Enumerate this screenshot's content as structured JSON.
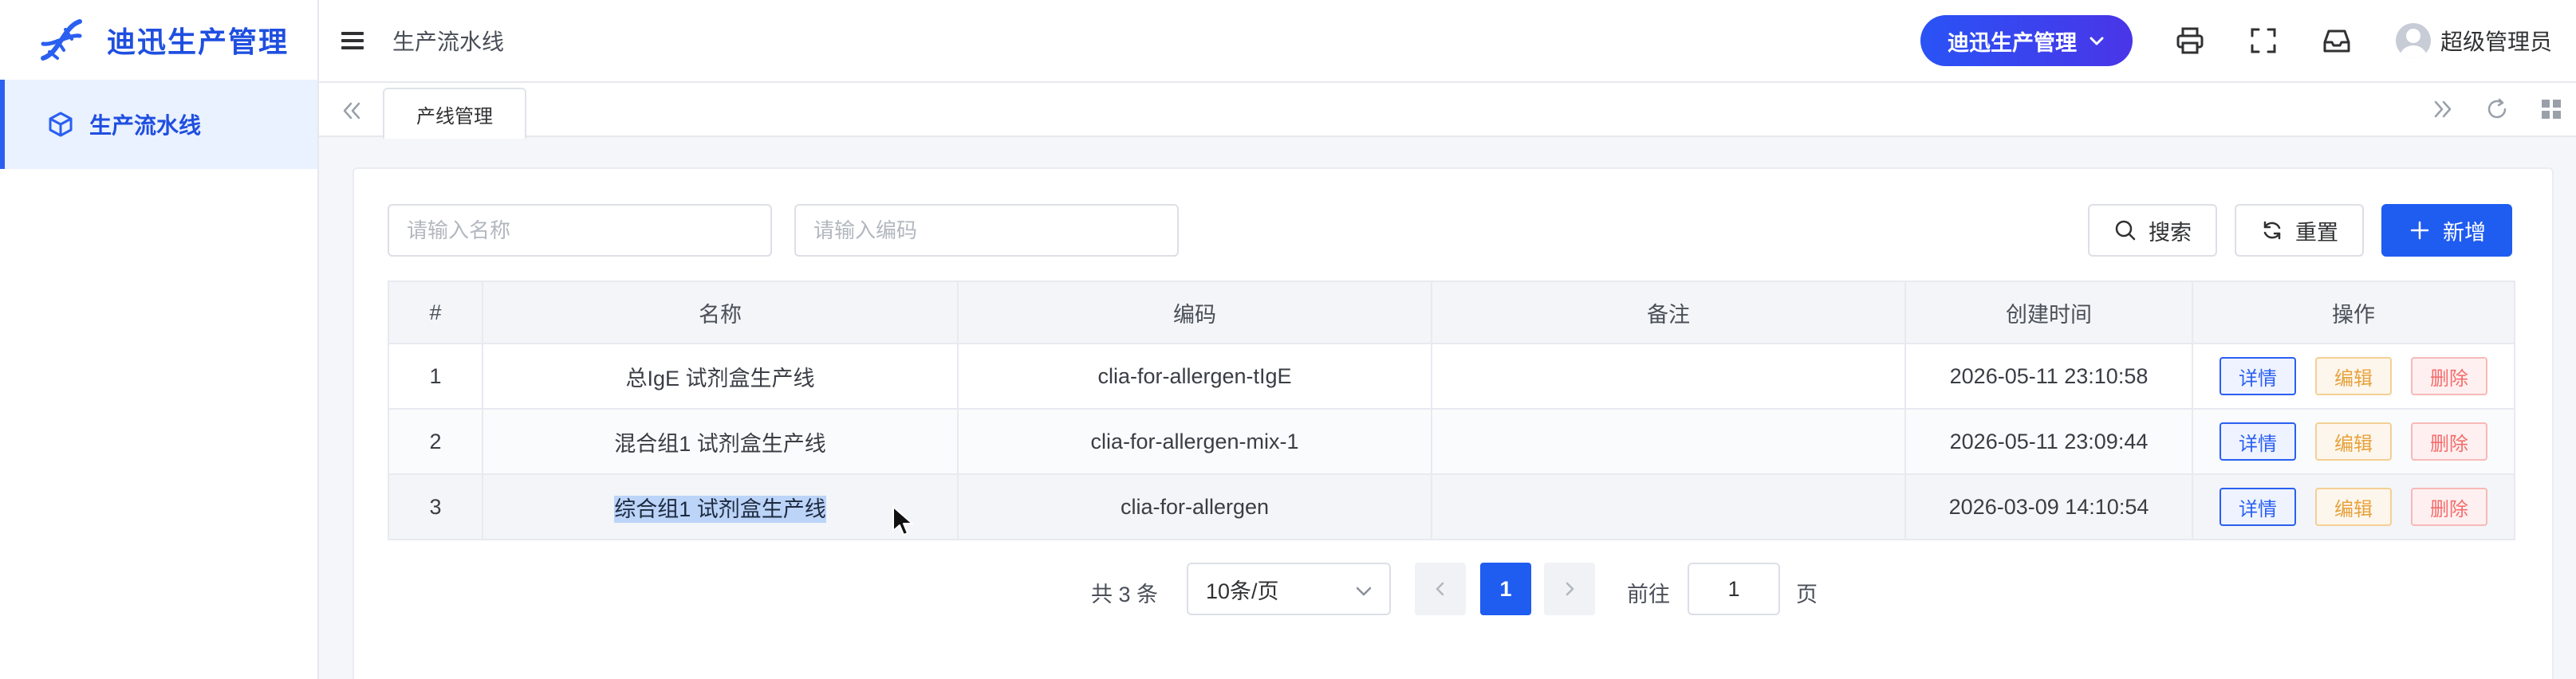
{
  "app": {
    "title": "迪迅生产管理"
  },
  "sidebar": {
    "items": [
      {
        "label": "生产流水线",
        "icon": "cube-icon",
        "active": true
      }
    ]
  },
  "header": {
    "breadcrumb": "生产流水线",
    "app_switch_label": "迪迅生产管理",
    "user_name": "超级管理员"
  },
  "tabs": [
    {
      "label": "产线管理",
      "active": true
    }
  ],
  "search": {
    "name_placeholder": "请输入名称",
    "code_placeholder": "请输入编码",
    "search_label": "搜索",
    "reset_label": "重置",
    "add_label": "新增"
  },
  "table": {
    "columns": [
      "#",
      "名称",
      "编码",
      "备注",
      "创建时间",
      "操作"
    ],
    "rows": [
      {
        "index": "1",
        "name": "总IgE 试剂盒生产线",
        "code": "clia-for-allergen-tIgE",
        "remark": "",
        "created": "2026-05-11 23:10:58"
      },
      {
        "index": "2",
        "name": "混合组1 试剂盒生产线",
        "code": "clia-for-allergen-mix-1",
        "remark": "",
        "created": "2026-05-11 23:09:44"
      },
      {
        "index": "3",
        "name": "综合组1 试剂盒生产线",
        "code": "clia-for-allergen",
        "remark": "",
        "created": "2026-03-09 14:10:54"
      }
    ],
    "actions": {
      "detail": "详情",
      "edit": "编辑",
      "delete": "删除"
    }
  },
  "pagination": {
    "total_text": "共 3 条",
    "page_size": "10条/页",
    "current_page": "1",
    "goto_label": "前往",
    "goto_value": "1",
    "page_suffix": "页"
  },
  "colors": {
    "primary": "#1f5cf0",
    "edit": "#e6a23c",
    "delete": "#f56c6c"
  }
}
